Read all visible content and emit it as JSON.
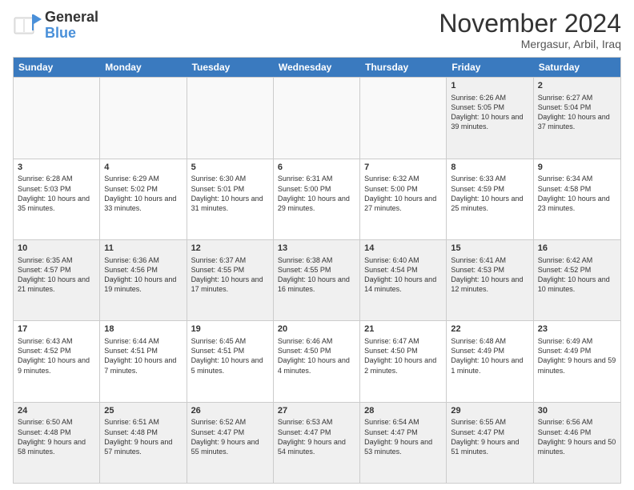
{
  "logo": {
    "line1": "General",
    "line2": "Blue"
  },
  "title": "November 2024",
  "location": "Mergasur, Arbil, Iraq",
  "header": {
    "days": [
      "Sunday",
      "Monday",
      "Tuesday",
      "Wednesday",
      "Thursday",
      "Friday",
      "Saturday"
    ]
  },
  "rows": [
    [
      {
        "day": "",
        "info": ""
      },
      {
        "day": "",
        "info": ""
      },
      {
        "day": "",
        "info": ""
      },
      {
        "day": "",
        "info": ""
      },
      {
        "day": "",
        "info": ""
      },
      {
        "day": "1",
        "info": "Sunrise: 6:26 AM\nSunset: 5:05 PM\nDaylight: 10 hours and 39 minutes."
      },
      {
        "day": "2",
        "info": "Sunrise: 6:27 AM\nSunset: 5:04 PM\nDaylight: 10 hours and 37 minutes."
      }
    ],
    [
      {
        "day": "3",
        "info": "Sunrise: 6:28 AM\nSunset: 5:03 PM\nDaylight: 10 hours and 35 minutes."
      },
      {
        "day": "4",
        "info": "Sunrise: 6:29 AM\nSunset: 5:02 PM\nDaylight: 10 hours and 33 minutes."
      },
      {
        "day": "5",
        "info": "Sunrise: 6:30 AM\nSunset: 5:01 PM\nDaylight: 10 hours and 31 minutes."
      },
      {
        "day": "6",
        "info": "Sunrise: 6:31 AM\nSunset: 5:00 PM\nDaylight: 10 hours and 29 minutes."
      },
      {
        "day": "7",
        "info": "Sunrise: 6:32 AM\nSunset: 5:00 PM\nDaylight: 10 hours and 27 minutes."
      },
      {
        "day": "8",
        "info": "Sunrise: 6:33 AM\nSunset: 4:59 PM\nDaylight: 10 hours and 25 minutes."
      },
      {
        "day": "9",
        "info": "Sunrise: 6:34 AM\nSunset: 4:58 PM\nDaylight: 10 hours and 23 minutes."
      }
    ],
    [
      {
        "day": "10",
        "info": "Sunrise: 6:35 AM\nSunset: 4:57 PM\nDaylight: 10 hours and 21 minutes."
      },
      {
        "day": "11",
        "info": "Sunrise: 6:36 AM\nSunset: 4:56 PM\nDaylight: 10 hours and 19 minutes."
      },
      {
        "day": "12",
        "info": "Sunrise: 6:37 AM\nSunset: 4:55 PM\nDaylight: 10 hours and 17 minutes."
      },
      {
        "day": "13",
        "info": "Sunrise: 6:38 AM\nSunset: 4:55 PM\nDaylight: 10 hours and 16 minutes."
      },
      {
        "day": "14",
        "info": "Sunrise: 6:40 AM\nSunset: 4:54 PM\nDaylight: 10 hours and 14 minutes."
      },
      {
        "day": "15",
        "info": "Sunrise: 6:41 AM\nSunset: 4:53 PM\nDaylight: 10 hours and 12 minutes."
      },
      {
        "day": "16",
        "info": "Sunrise: 6:42 AM\nSunset: 4:52 PM\nDaylight: 10 hours and 10 minutes."
      }
    ],
    [
      {
        "day": "17",
        "info": "Sunrise: 6:43 AM\nSunset: 4:52 PM\nDaylight: 10 hours and 9 minutes."
      },
      {
        "day": "18",
        "info": "Sunrise: 6:44 AM\nSunset: 4:51 PM\nDaylight: 10 hours and 7 minutes."
      },
      {
        "day": "19",
        "info": "Sunrise: 6:45 AM\nSunset: 4:51 PM\nDaylight: 10 hours and 5 minutes."
      },
      {
        "day": "20",
        "info": "Sunrise: 6:46 AM\nSunset: 4:50 PM\nDaylight: 10 hours and 4 minutes."
      },
      {
        "day": "21",
        "info": "Sunrise: 6:47 AM\nSunset: 4:50 PM\nDaylight: 10 hours and 2 minutes."
      },
      {
        "day": "22",
        "info": "Sunrise: 6:48 AM\nSunset: 4:49 PM\nDaylight: 10 hours and 1 minute."
      },
      {
        "day": "23",
        "info": "Sunrise: 6:49 AM\nSunset: 4:49 PM\nDaylight: 9 hours and 59 minutes."
      }
    ],
    [
      {
        "day": "24",
        "info": "Sunrise: 6:50 AM\nSunset: 4:48 PM\nDaylight: 9 hours and 58 minutes."
      },
      {
        "day": "25",
        "info": "Sunrise: 6:51 AM\nSunset: 4:48 PM\nDaylight: 9 hours and 57 minutes."
      },
      {
        "day": "26",
        "info": "Sunrise: 6:52 AM\nSunset: 4:47 PM\nDaylight: 9 hours and 55 minutes."
      },
      {
        "day": "27",
        "info": "Sunrise: 6:53 AM\nSunset: 4:47 PM\nDaylight: 9 hours and 54 minutes."
      },
      {
        "day": "28",
        "info": "Sunrise: 6:54 AM\nSunset: 4:47 PM\nDaylight: 9 hours and 53 minutes."
      },
      {
        "day": "29",
        "info": "Sunrise: 6:55 AM\nSunset: 4:47 PM\nDaylight: 9 hours and 51 minutes."
      },
      {
        "day": "30",
        "info": "Sunrise: 6:56 AM\nSunset: 4:46 PM\nDaylight: 9 hours and 50 minutes."
      }
    ]
  ]
}
